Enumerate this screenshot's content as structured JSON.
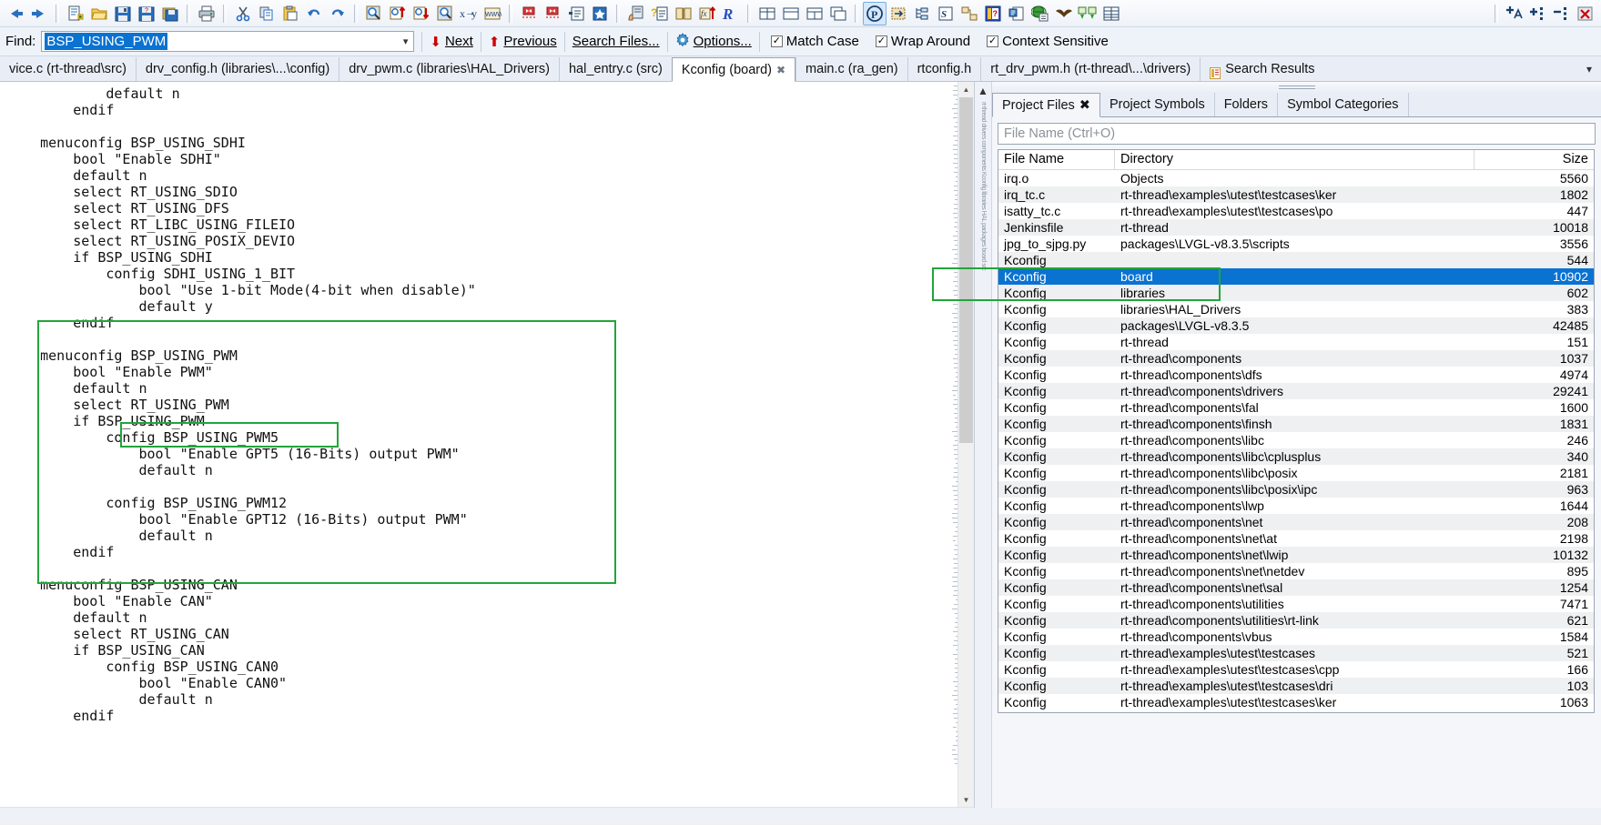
{
  "toolbar": {
    "groups": [
      {
        "name": "nav",
        "buttons": [
          {
            "name": "back-icon",
            "label": "Back"
          },
          {
            "name": "forward-icon",
            "label": "Forward"
          }
        ]
      },
      {
        "name": "file",
        "buttons": [
          {
            "name": "new-file-icon",
            "label": "New File"
          },
          {
            "name": "open-file-icon",
            "label": "Open File"
          },
          {
            "name": "save-icon",
            "label": "Save"
          },
          {
            "name": "save-as-icon",
            "label": "Save As"
          },
          {
            "name": "save-all-icon",
            "label": "Save All"
          },
          {
            "name": "print-icon",
            "label": "Print"
          }
        ]
      },
      {
        "name": "edit",
        "buttons": [
          {
            "name": "cut-icon",
            "label": "Cut"
          },
          {
            "name": "copy-icon",
            "label": "Copy"
          },
          {
            "name": "paste-icon",
            "label": "Paste"
          },
          {
            "name": "undo-icon",
            "label": "Undo"
          },
          {
            "name": "redo-icon",
            "label": "Redo"
          }
        ]
      },
      {
        "name": "search",
        "buttons": [
          {
            "name": "search-icon",
            "label": "Search"
          },
          {
            "name": "search-backward-icon",
            "label": "Search Backward"
          },
          {
            "name": "search-forward-icon",
            "label": "Search Forward"
          },
          {
            "name": "search-files-icon",
            "label": "Search Files"
          },
          {
            "name": "replace-icon",
            "label": "Replace"
          },
          {
            "name": "web-search-icon",
            "label": "Web Search"
          }
        ]
      },
      {
        "name": "bookmarks",
        "buttons": [
          {
            "name": "jump-back-icon",
            "label": "Jump Back"
          },
          {
            "name": "jump-forward-icon",
            "label": "Jump Forward"
          },
          {
            "name": "bookmark-list-icon",
            "label": "Bookmarks"
          },
          {
            "name": "add-bookmark-icon",
            "label": "Add Bookmark"
          }
        ]
      },
      {
        "name": "symbols",
        "buttons": [
          {
            "name": "highlight-icon",
            "label": "Highlight"
          },
          {
            "name": "context-help-icon",
            "label": "Context Help"
          },
          {
            "name": "reference-icon",
            "label": "Reference"
          },
          {
            "name": "function-jump-icon",
            "label": "Jump to Function"
          },
          {
            "name": "relation-window-icon",
            "label": "Relation Window"
          }
        ]
      },
      {
        "name": "layout",
        "buttons": [
          {
            "name": "tile-windows-icon",
            "label": "Tile"
          },
          {
            "name": "single-window-icon",
            "label": "Single"
          },
          {
            "name": "split-window-icon",
            "label": "Split"
          },
          {
            "name": "cascade-windows-icon",
            "label": "Cascade"
          }
        ]
      },
      {
        "name": "project",
        "buttons": [
          {
            "name": "project-icon",
            "label": "Project"
          },
          {
            "name": "sync-files-icon",
            "label": "Synchronize Files"
          },
          {
            "name": "symbol-tree-icon",
            "label": "Symbol Tree"
          },
          {
            "name": "source-browser-icon",
            "label": "Source Browser"
          },
          {
            "name": "file-relations-icon",
            "label": "File Relations"
          },
          {
            "name": "context-window-icon",
            "label": "Context Window"
          },
          {
            "name": "file-properties-icon",
            "label": "File Properties"
          },
          {
            "name": "globe-icon",
            "label": "Web"
          },
          {
            "name": "eagle-icon",
            "label": "Source Dynamics"
          },
          {
            "name": "compare-files-icon",
            "label": "Compare Files"
          },
          {
            "name": "table-icon",
            "label": "Table"
          }
        ]
      },
      {
        "name": "zoom",
        "buttons": [
          {
            "name": "increase-font-icon",
            "label": "Increase Font"
          },
          {
            "name": "expand-all-icon",
            "label": "Expand All"
          },
          {
            "name": "collapse-all-icon",
            "label": "Collapse All"
          },
          {
            "name": "clear-highlight-icon",
            "label": "Clear Highlight"
          }
        ]
      }
    ]
  },
  "findbar": {
    "label": "Find:",
    "value": "BSP_USING_PWM",
    "dropdown_icon": "chevron-down-icon",
    "next": "Next",
    "previous": "Previous",
    "search_files": "Search Files...",
    "options": "Options...",
    "options_icon": "gear-icon",
    "checkboxes": [
      {
        "label": "Match Case",
        "checked": true
      },
      {
        "label": "Wrap Around",
        "checked": true
      },
      {
        "label": "Context Sensitive",
        "checked": true
      }
    ]
  },
  "tabs": [
    {
      "label": "vice.c (rt-thread\\src)",
      "active": false,
      "closable": false
    },
    {
      "label": "drv_config.h (libraries\\...\\config)",
      "active": false,
      "closable": false
    },
    {
      "label": "drv_pwm.c (libraries\\HAL_Drivers)",
      "active": false,
      "closable": false
    },
    {
      "label": "hal_entry.c (src)",
      "active": false,
      "closable": false
    },
    {
      "label": "Kconfig (board)",
      "active": true,
      "closable": true
    },
    {
      "label": "main.c (ra_gen)",
      "active": false,
      "closable": false
    },
    {
      "label": "rtconfig.h",
      "active": false,
      "closable": false
    },
    {
      "label": "rt_drv_pwm.h (rt-thread\\...\\drivers)",
      "active": false,
      "closable": false
    },
    {
      "label": "Search Results",
      "active": false,
      "closable": false,
      "icon": "search-results-icon"
    }
  ],
  "tab_overflow_icon": "chevron-down-icon",
  "editor": {
    "file": "Kconfig (board)",
    "lines": [
      "            default n",
      "        endif",
      "",
      "    menuconfig BSP_USING_SDHI",
      "        bool \"Enable SDHI\"",
      "        default n",
      "        select RT_USING_SDIO",
      "        select RT_USING_DFS",
      "        select RT_LIBC_USING_FILEIO",
      "        select RT_USING_POSIX_DEVIO",
      "        if BSP_USING_SDHI",
      "            config SDHI_USING_1_BIT",
      "                bool \"Use 1-bit Mode(4-bit when disable)\"",
      "                default y",
      "        endif",
      "",
      "    menuconfig BSP_USING_PWM",
      "        bool \"Enable PWM\"",
      "        default n",
      "        select RT_USING_PWM",
      "        if BSP_USING_PWM",
      "            config BSP_USING_PWM5",
      "                bool \"Enable GPT5 (16-Bits) output PWM\"",
      "                default n",
      "",
      "            config BSP_USING_PWM12",
      "                bool \"Enable GPT12 (16-Bits) output PWM\"",
      "                default n",
      "        endif",
      "",
      "    menuconfig BSP_USING_CAN",
      "        bool \"Enable CAN\"",
      "        default n",
      "        select RT_USING_CAN",
      "        if BSP_USING_CAN",
      "            config BSP_USING_CAN0",
      "                bool \"Enable CAN0\"",
      "                default n",
      "        endif"
    ]
  },
  "annotations": {
    "color": "#22a53a",
    "boxes": [
      {
        "name": "pwm-block-highlight",
        "desc": "green box around menuconfig BSP_USING_PWM block"
      },
      {
        "name": "pwm5-config-highlight",
        "desc": "green box around config BSP_USING_PWM5"
      },
      {
        "name": "kconfig-board-row-highlight",
        "desc": "green box around Kconfig board row in file list"
      }
    ]
  },
  "right_panel": {
    "tabs": [
      {
        "label": "Project Files",
        "active": true,
        "closable": true
      },
      {
        "label": "Project Symbols",
        "active": false,
        "closable": false
      },
      {
        "label": "Folders",
        "active": false,
        "closable": false
      },
      {
        "label": "Symbol Categories",
        "active": false,
        "closable": false
      }
    ],
    "filter": {
      "placeholder": "File Name (Ctrl+O)",
      "value": ""
    },
    "columns": [
      "File Name",
      "Directory",
      "Size"
    ],
    "rows": [
      {
        "name": "irq.o",
        "dir": "Objects",
        "size": "5560",
        "selected": false
      },
      {
        "name": "irq_tc.c",
        "dir": "rt-thread\\examples\\utest\\testcases\\ker",
        "size": "1802",
        "selected": false
      },
      {
        "name": "isatty_tc.c",
        "dir": "rt-thread\\examples\\utest\\testcases\\po",
        "size": "447",
        "selected": false
      },
      {
        "name": "Jenkinsfile",
        "dir": "rt-thread",
        "size": "10018",
        "selected": false
      },
      {
        "name": "jpg_to_sjpg.py",
        "dir": "packages\\LVGL-v8.3.5\\scripts",
        "size": "3556",
        "selected": false
      },
      {
        "name": "Kconfig",
        "dir": "",
        "size": "544",
        "selected": false
      },
      {
        "name": "Kconfig",
        "dir": "board",
        "size": "10902",
        "selected": true
      },
      {
        "name": "Kconfig",
        "dir": "libraries",
        "size": "602",
        "selected": false
      },
      {
        "name": "Kconfig",
        "dir": "libraries\\HAL_Drivers",
        "size": "383",
        "selected": false
      },
      {
        "name": "Kconfig",
        "dir": "packages\\LVGL-v8.3.5",
        "size": "42485",
        "selected": false
      },
      {
        "name": "Kconfig",
        "dir": "rt-thread",
        "size": "151",
        "selected": false
      },
      {
        "name": "Kconfig",
        "dir": "rt-thread\\components",
        "size": "1037",
        "selected": false
      },
      {
        "name": "Kconfig",
        "dir": "rt-thread\\components\\dfs",
        "size": "4974",
        "selected": false
      },
      {
        "name": "Kconfig",
        "dir": "rt-thread\\components\\drivers",
        "size": "29241",
        "selected": false
      },
      {
        "name": "Kconfig",
        "dir": "rt-thread\\components\\fal",
        "size": "1600",
        "selected": false
      },
      {
        "name": "Kconfig",
        "dir": "rt-thread\\components\\finsh",
        "size": "1831",
        "selected": false
      },
      {
        "name": "Kconfig",
        "dir": "rt-thread\\components\\libc",
        "size": "246",
        "selected": false
      },
      {
        "name": "Kconfig",
        "dir": "rt-thread\\components\\libc\\cplusplus",
        "size": "340",
        "selected": false
      },
      {
        "name": "Kconfig",
        "dir": "rt-thread\\components\\libc\\posix",
        "size": "2181",
        "selected": false
      },
      {
        "name": "Kconfig",
        "dir": "rt-thread\\components\\libc\\posix\\ipc",
        "size": "963",
        "selected": false
      },
      {
        "name": "Kconfig",
        "dir": "rt-thread\\components\\lwp",
        "size": "1644",
        "selected": false
      },
      {
        "name": "Kconfig",
        "dir": "rt-thread\\components\\net",
        "size": "208",
        "selected": false
      },
      {
        "name": "Kconfig",
        "dir": "rt-thread\\components\\net\\at",
        "size": "2198",
        "selected": false
      },
      {
        "name": "Kconfig",
        "dir": "rt-thread\\components\\net\\lwip",
        "size": "10132",
        "selected": false
      },
      {
        "name": "Kconfig",
        "dir": "rt-thread\\components\\net\\netdev",
        "size": "895",
        "selected": false
      },
      {
        "name": "Kconfig",
        "dir": "rt-thread\\components\\net\\sal",
        "size": "1254",
        "selected": false
      },
      {
        "name": "Kconfig",
        "dir": "rt-thread\\components\\utilities",
        "size": "7471",
        "selected": false
      },
      {
        "name": "Kconfig",
        "dir": "rt-thread\\components\\utilities\\rt-link",
        "size": "621",
        "selected": false
      },
      {
        "name": "Kconfig",
        "dir": "rt-thread\\components\\vbus",
        "size": "1584",
        "selected": false
      },
      {
        "name": "Kconfig",
        "dir": "rt-thread\\examples\\utest\\testcases",
        "size": "521",
        "selected": false
      },
      {
        "name": "Kconfig",
        "dir": "rt-thread\\examples\\utest\\testcases\\cpp",
        "size": "166",
        "selected": false
      },
      {
        "name": "Kconfig",
        "dir": "rt-thread\\examples\\utest\\testcases\\dri",
        "size": "103",
        "selected": false
      },
      {
        "name": "Kconfig",
        "dir": "rt-thread\\examples\\utest\\testcases\\ker",
        "size": "1063",
        "selected": false
      }
    ],
    "bottom_icons": [
      {
        "name": "open-folder-icon"
      },
      {
        "name": "project-icon"
      },
      {
        "name": "file-list-icon"
      },
      {
        "name": "settings-gear-icon"
      }
    ]
  }
}
